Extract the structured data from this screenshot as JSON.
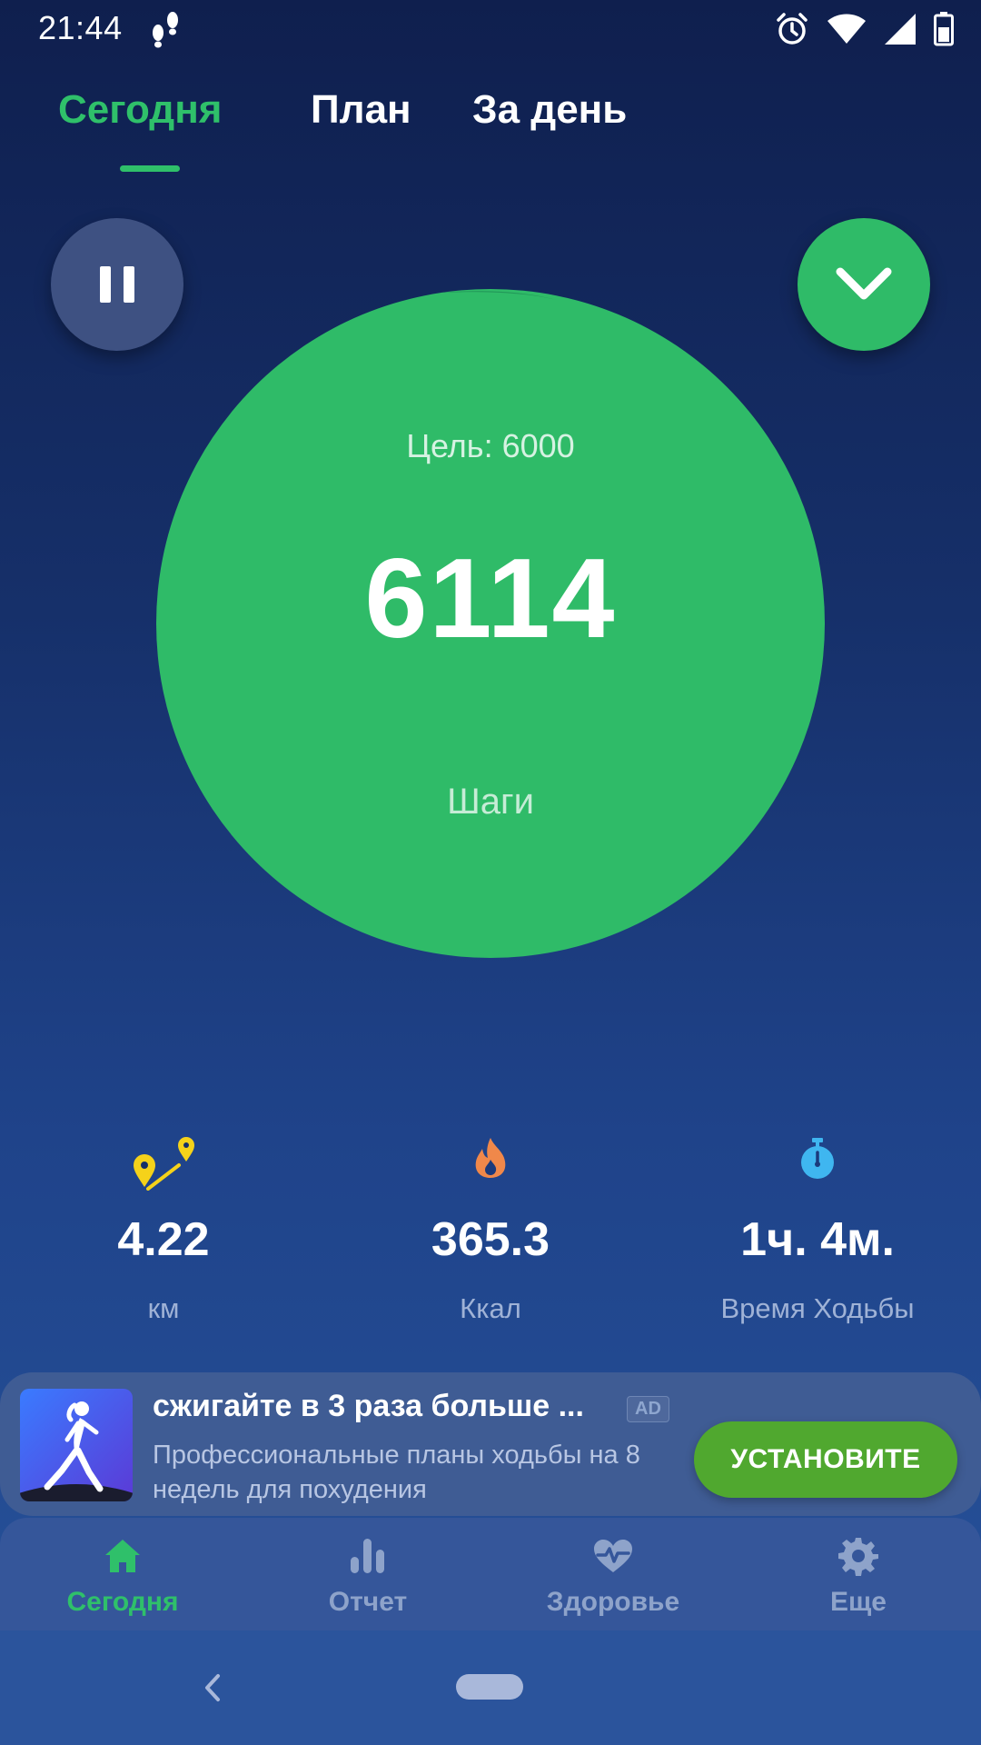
{
  "status_bar": {
    "time": "21:44",
    "icons": [
      "footsteps-icon",
      "alarm-icon",
      "wifi-icon",
      "signal-icon",
      "battery-icon"
    ]
  },
  "tabs": [
    {
      "label": "Сегодня",
      "active": true
    },
    {
      "label": "План",
      "active": false
    },
    {
      "label": "За день",
      "active": false
    }
  ],
  "controls": {
    "pause_icon": "pause-icon",
    "expand_icon": "chevron-down-icon"
  },
  "progress": {
    "goal_text": "Цель: 6000",
    "steps": "6114",
    "steps_label": "Шаги",
    "goal": 6000,
    "fraction_of_goal": 1.019
  },
  "stats": [
    {
      "icon": "distance-pins-icon",
      "value": "4.22",
      "unit": "км",
      "color": "#f5d21a"
    },
    {
      "icon": "flame-icon",
      "value": "365.3",
      "unit": "Ккал",
      "color": "#f0884a"
    },
    {
      "icon": "stopwatch-icon",
      "value": "1ч. 4м.",
      "unit": "Время Ходьбы",
      "color": "#3fb6f0"
    }
  ],
  "ad": {
    "title": "сжигайте в 3 раза больше ...",
    "badge": "AD",
    "description": "Профессиональные планы ходьбы на 8 недель для похудения",
    "cta": "УСТАНОВИТЕ",
    "thumb_icon": "walking-woman-icon"
  },
  "bottom_nav": [
    {
      "icon": "home-icon",
      "label": "Сегодня",
      "active": true
    },
    {
      "icon": "bar-chart-icon",
      "label": "Отчет",
      "active": false
    },
    {
      "icon": "heart-pulse-icon",
      "label": "Здоровье",
      "active": false
    },
    {
      "icon": "gear-icon",
      "label": "Еще",
      "active": false
    }
  ],
  "colors": {
    "accent_green": "#2fbb68",
    "active_tab": "#2fc06a",
    "background_top": "#0f1f4e",
    "background_bottom": "#27539b",
    "install_button": "#50a82f"
  }
}
